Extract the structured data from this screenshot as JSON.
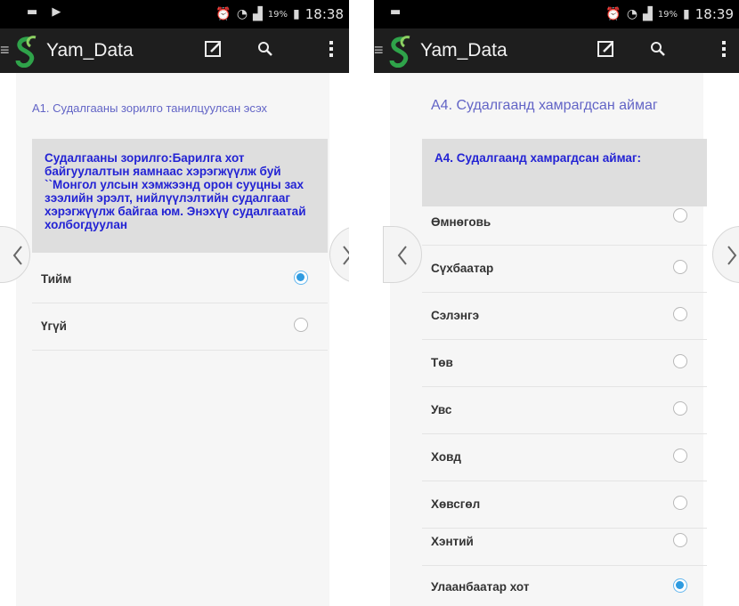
{
  "left_screen": {
    "status": {
      "time": "18:38",
      "battery": "19%"
    },
    "app": {
      "title": "Yam_Data"
    },
    "question_title": "А1. Судалгааны зорилго танилцуулсан эсэх",
    "question_text": "Судалгааны зорилго:Барилга хот байгуулалтын яамнаас хэрэгжүүлж буй ``Монгол улсын хэмжээнд орон сууцны зах зээлийн эрэлт, нийлүүлэлтийн судалгааг хэрэгжүүлж байгаа юм. Энэхүү судалгаатай холбогдуулан",
    "options": [
      {
        "label": "Тийм",
        "selected": true
      },
      {
        "label": "Үгүй",
        "selected": false
      }
    ]
  },
  "right_screen": {
    "status": {
      "time": "18:39",
      "battery": "19%"
    },
    "app": {
      "title": "Yam_Data"
    },
    "question_title": "А4. Судалгаанд хамрагдсан аймаг",
    "question_text": "А4. Судалгаанд хамрагдсан аймаг:",
    "options": [
      {
        "label": "Өмнөговь",
        "selected": false
      },
      {
        "label": "Сүхбаатар",
        "selected": false
      },
      {
        "label": "Сэлэнгэ",
        "selected": false
      },
      {
        "label": "Төв",
        "selected": false
      },
      {
        "label": "Увс",
        "selected": false
      },
      {
        "label": "Ховд",
        "selected": false
      },
      {
        "label": "Хөвсгөл",
        "selected": false
      },
      {
        "label": "Хэнтий",
        "selected": false
      },
      {
        "label": "Улаанбаатар хот",
        "selected": true
      }
    ]
  },
  "icons": [
    "menu-icon",
    "app-logo-icon",
    "edit-icon",
    "search-icon",
    "overflow-menu-icon",
    "chevron-left-icon",
    "chevron-right-icon",
    "alarm-icon",
    "wifi-icon",
    "signal-icon",
    "battery-icon"
  ],
  "colors": {
    "accent": "#2f9be0",
    "question_text": "#2323d4",
    "title_text": "#6264c6",
    "appbar": "#1e1e1e"
  }
}
